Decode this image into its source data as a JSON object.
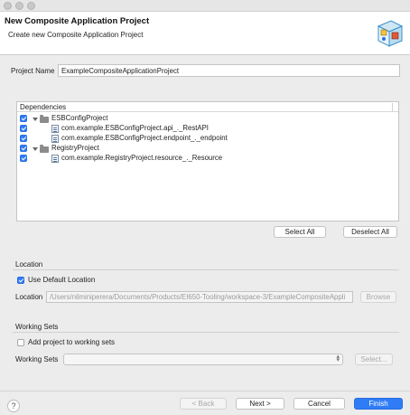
{
  "window": {
    "title": "New Composite Application Project",
    "subtitle": "Create new Composite Application Project",
    "logo_icon": "wizard-cube-icon"
  },
  "project": {
    "name_label": "Project Name",
    "name_value": "ExampleCompositeApplicationProject"
  },
  "dependencies": {
    "header": "Dependencies",
    "items": [
      {
        "label": "ESBConfigProject",
        "checked": true,
        "type": "folder"
      },
      {
        "label": "com.example.ESBConfigProject.api_._RestAPI",
        "checked": true,
        "type": "file"
      },
      {
        "label": "com.example.ESBConfigProject.endpoint_._endpoint",
        "checked": true,
        "type": "file"
      },
      {
        "label": "RegistryProject",
        "checked": true,
        "type": "folder"
      },
      {
        "label": "com.example.RegistryProject.resource_._Resource",
        "checked": true,
        "type": "file"
      }
    ],
    "select_all_label": "Select All",
    "deselect_all_label": "Deselect All"
  },
  "location": {
    "section_label": "Location",
    "use_default_label": "Use Default Location",
    "use_default_checked": true,
    "field_label": "Location",
    "field_value": "/Users/nilminiperera/Documents/Products/EI650-Tooling/workspace-3/ExampleCompositeAppli",
    "browse_label": "Browse"
  },
  "working_sets": {
    "section_label": "Working Sets",
    "add_label": "Add project to working sets",
    "add_checked": false,
    "field_label": "Working Sets",
    "select_label": "Select..."
  },
  "footer": {
    "help_label": "?",
    "back_label": "< Back",
    "next_label": "Next >",
    "cancel_label": "Cancel",
    "finish_label": "Finish"
  },
  "colors": {
    "accent": "#2f7cf6"
  }
}
